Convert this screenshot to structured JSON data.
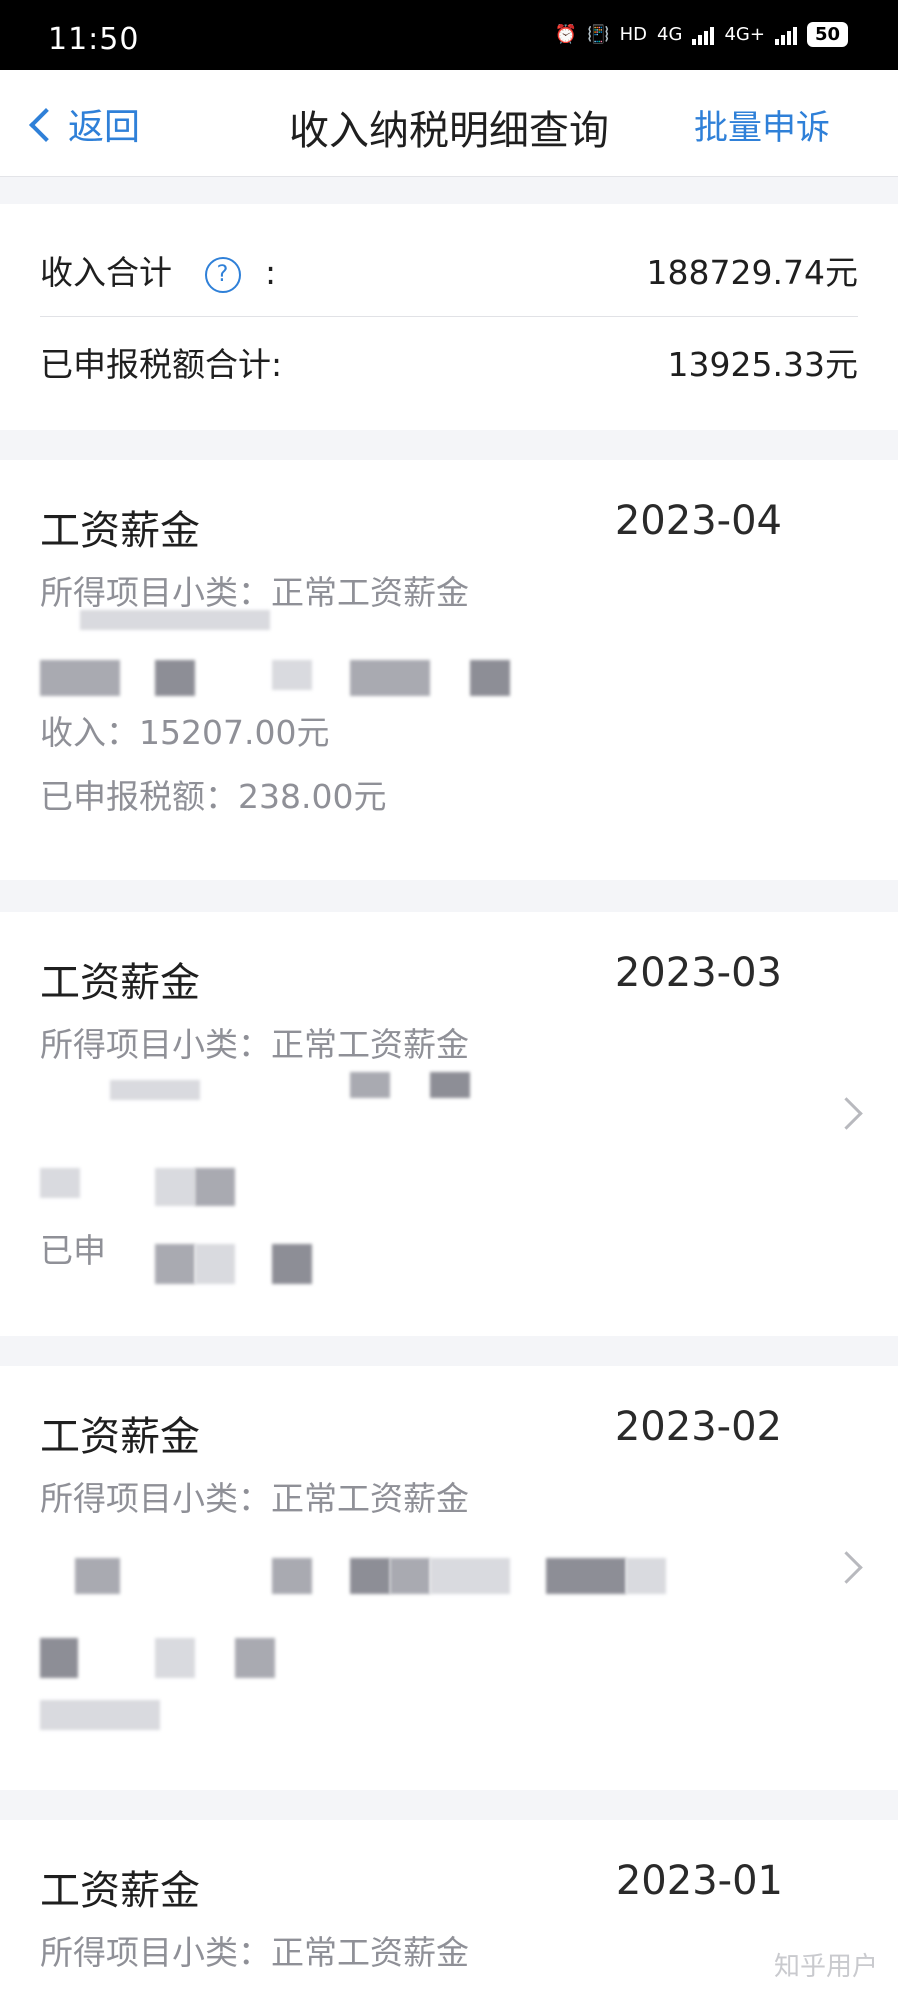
{
  "status_bar": {
    "time": "11:50",
    "network_hd": "HD",
    "network_1": "4G",
    "network_2": "4G+",
    "battery": "50"
  },
  "nav": {
    "back_label": "返回",
    "title": "收入纳税明细查询",
    "action_label": "批量申诉"
  },
  "summary": {
    "income_label": "收入合计",
    "help_icon_glyph": "?",
    "colon": ":",
    "income_value": "188729.74元",
    "tax_label": "已申报税额合计:",
    "tax_value": "13925.33元"
  },
  "records": [
    {
      "title": "工资薪金",
      "date": "2023-04",
      "subcategory": "所得项目小类：正常工资薪金",
      "income": "收入：15207.00元",
      "tax": "已申报税额：238.00元"
    },
    {
      "title": "工资薪金",
      "date": "2023-03",
      "subcategory": "所得项目小类：正常工资薪金",
      "tax_partial": "已申"
    },
    {
      "title": "工资薪金",
      "date": "2023-02",
      "subcategory": "所得项目小类：正常工资薪金"
    },
    {
      "title": "工资薪金",
      "date": "2023-01",
      "subcategory": "所得项目小类：正常工资薪金"
    }
  ],
  "watermark": "知乎用户",
  "colors": {
    "accent": "#2f80d8",
    "background": "#f4f5f8",
    "muted_text": "#8f9097"
  }
}
